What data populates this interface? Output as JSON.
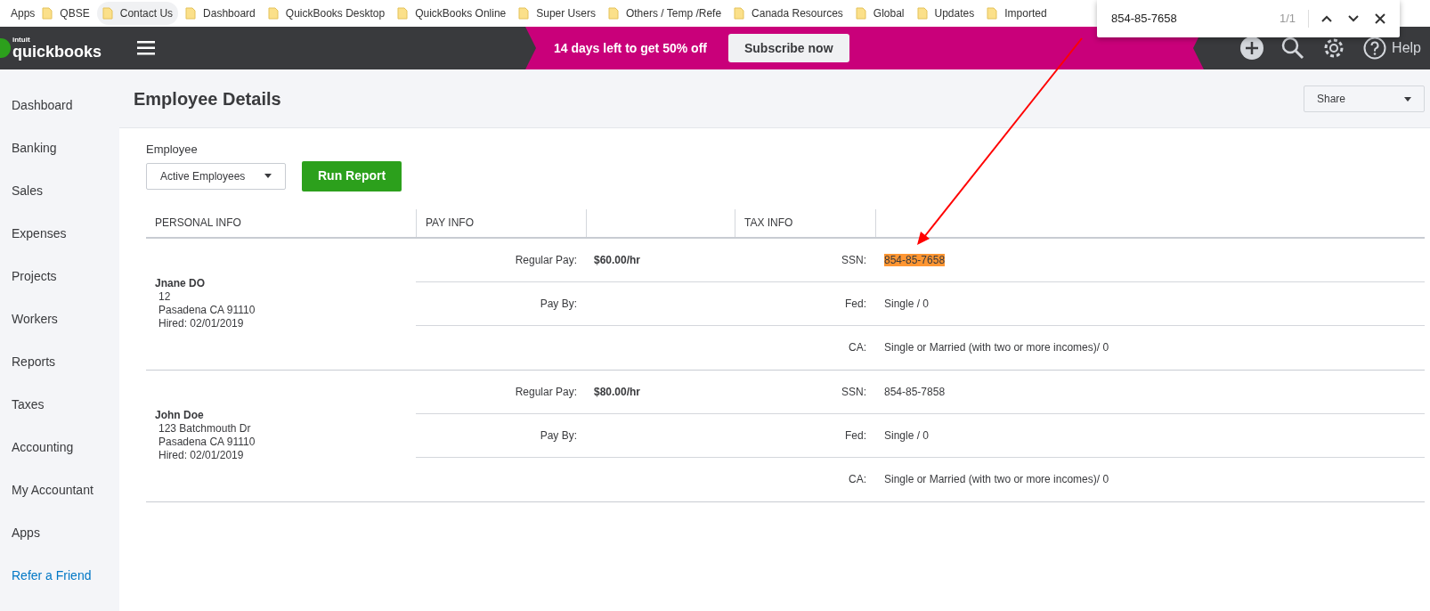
{
  "bookmarks_bar": {
    "apps": "Apps",
    "items": [
      {
        "label": "QBSE",
        "hovered": false
      },
      {
        "label": "Contact Us",
        "hovered": true
      },
      {
        "label": "Dashboard",
        "hovered": false
      },
      {
        "label": "QuickBooks Desktop",
        "hovered": false
      },
      {
        "label": "QuickBooks Online",
        "hovered": false
      },
      {
        "label": "Super Users",
        "hovered": false
      },
      {
        "label": "Others / Temp /Refe",
        "hovered": false
      },
      {
        "label": "Canada Resources",
        "hovered": false
      },
      {
        "label": "Global",
        "hovered": false
      },
      {
        "label": "Updates",
        "hovered": false
      },
      {
        "label": "Imported",
        "hovered": false
      }
    ]
  },
  "find_bar": {
    "query": "854-85-7658",
    "count": "1/1"
  },
  "top_nav": {
    "logo_small": "intuit",
    "logo": "quickbooks",
    "promo": "14 days left to get **50%** off",
    "subscribe_button": "Subscribe now",
    "help": "Help"
  },
  "sidebar": {
    "items": [
      {
        "label": "Dashboard",
        "kind": "item"
      },
      {
        "label": "Banking",
        "kind": "item"
      },
      {
        "label": "Sales",
        "kind": "item"
      },
      {
        "label": "Expenses",
        "kind": "item"
      },
      {
        "label": "Projects",
        "kind": "item"
      },
      {
        "label": "Workers",
        "kind": "item"
      },
      {
        "label": "Reports",
        "kind": "item"
      },
      {
        "label": "Taxes",
        "kind": "item"
      },
      {
        "label": "Accounting",
        "kind": "item"
      },
      {
        "label": "My Accountant",
        "kind": "item"
      },
      {
        "label": "Apps",
        "kind": "item"
      },
      {
        "label": "Refer a Friend",
        "kind": "link"
      }
    ]
  },
  "page": {
    "title": "Employee Details",
    "share": "Share"
  },
  "filter": {
    "label": "Employee",
    "value": "Active Employees",
    "run_button": "Run Report"
  },
  "table": {
    "columns": [
      "PERSONAL INFO",
      "PAY INFO",
      "",
      "TAX INFO",
      ""
    ],
    "employees": [
      {
        "name": "Jnane DO",
        "lines": [
          "12",
          "Pasadena CA 91110",
          "Hired: 02/01/2019"
        ],
        "rows": [
          {
            "pay_label": "Regular Pay:",
            "pay_value": "$60.00/hr",
            "tax_label": "SSN:",
            "tax_value": "854-85-7658",
            "highlighted": true
          },
          {
            "pay_label": "Pay By:",
            "tax_label": "Fed:",
            "tax_value": "Single / 0",
            "highlighted": false
          },
          {
            "tax_label": "CA:",
            "tax_value": "Single or Married (with two or more incomes)/ 0",
            "highlighted": false
          }
        ]
      },
      {
        "name": "John Doe",
        "lines": [
          "123 Batchmouth Dr",
          "Pasadena CA 91110",
          "Hired: 02/01/2019"
        ],
        "rows": [
          {
            "pay_label": "Regular Pay:",
            "pay_value": "$80.00/hr",
            "tax_label": "SSN:",
            "tax_value": "854-85-7858",
            "highlighted": false
          },
          {
            "pay_label": "Pay By:",
            "tax_label": "Fed:",
            "tax_value": "Single / 0",
            "highlighted": false
          },
          {
            "tax_label": "CA:",
            "tax_value": "Single or Married (with two or more incomes)/ 0",
            "highlighted": false
          }
        ]
      }
    ]
  }
}
